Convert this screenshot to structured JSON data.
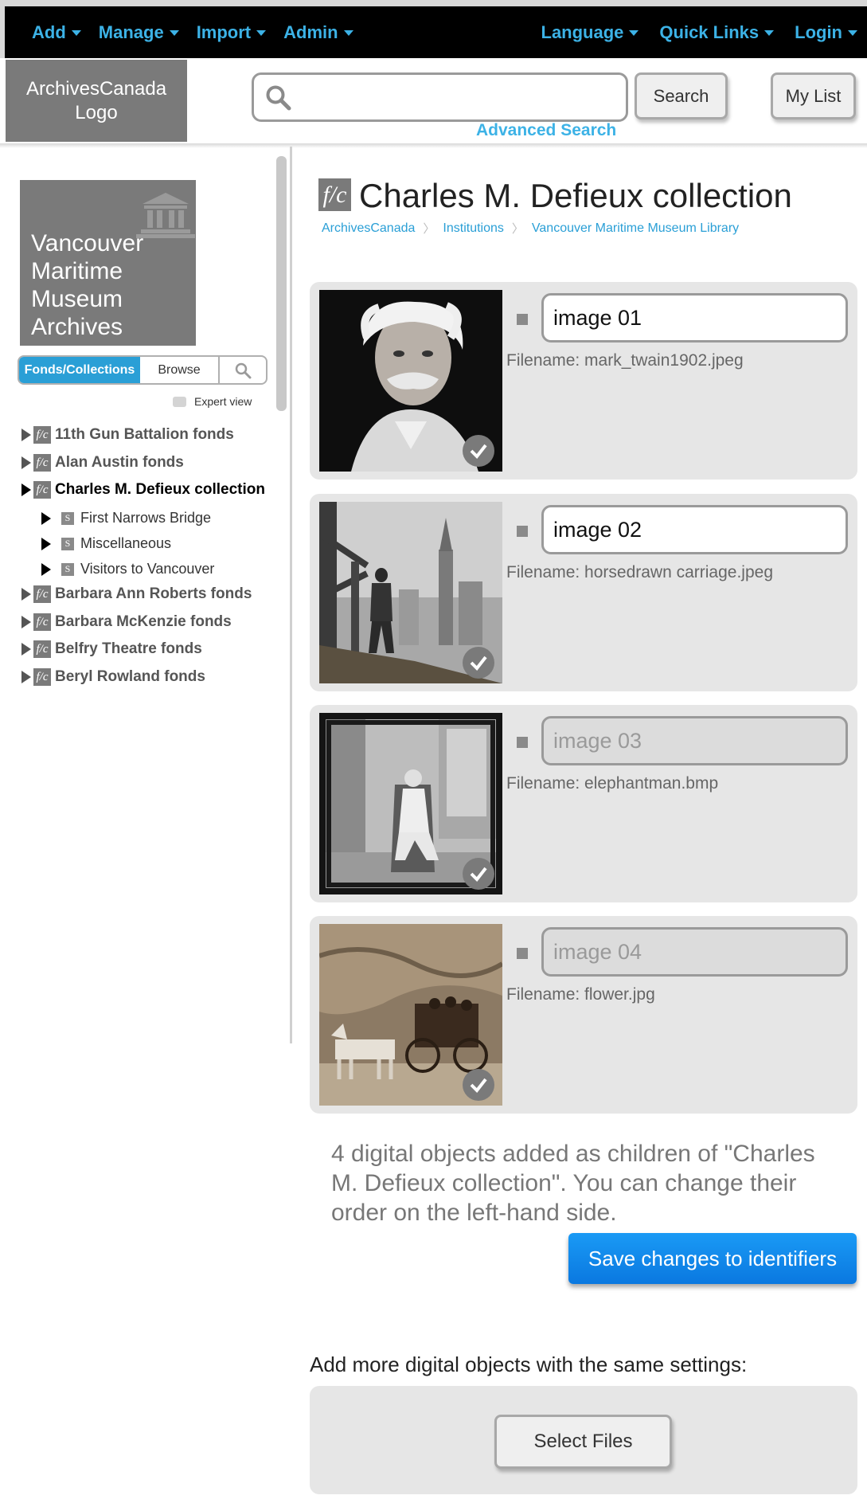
{
  "topnav": {
    "left": [
      {
        "label": "Add"
      },
      {
        "label": "Manage"
      },
      {
        "label": "Import"
      },
      {
        "label": "Admin"
      }
    ],
    "right": [
      {
        "label": "Language"
      },
      {
        "label": "Quick Links"
      },
      {
        "label": "Login"
      }
    ],
    "accent_color": "#3cb2e6"
  },
  "header": {
    "logo_text": "ArchivesCanada Logo",
    "search_value": "",
    "search_button": "Search",
    "my_list_button": "My List",
    "advanced_search": "Advanced Search"
  },
  "sidebar": {
    "institution_name": "Vancouver Maritime Museum Archives",
    "tabs": [
      {
        "label": "Fonds/Collections",
        "active": true
      },
      {
        "label": "Browse",
        "active": false
      }
    ],
    "expert_view_label": "Expert view",
    "tree": [
      {
        "label": "11th Gun Battalion fonds",
        "icon": "f/c"
      },
      {
        "label": "Alan Austin fonds",
        "icon": "f/c"
      },
      {
        "label": "Charles M. Defieux collection",
        "icon": "f/c",
        "active": true
      },
      {
        "label": "First Narrows Bridge",
        "icon": "S"
      },
      {
        "label": "Miscellaneous",
        "icon": "S"
      },
      {
        "label": "Visitors to Vancouver",
        "icon": "S"
      },
      {
        "label": "Barbara Ann Roberts fonds",
        "icon": "f/c"
      },
      {
        "label": "Barbara McKenzie fonds",
        "icon": "f/c"
      },
      {
        "label": "Belfry Theatre fonds",
        "icon": "f/c"
      },
      {
        "label": "Beryl Rowland fonds",
        "icon": "f/c"
      }
    ]
  },
  "main": {
    "title_icon": "f/c",
    "title": "Charles M. Defieux collection",
    "breadcrumb": [
      "ArchivesCanada",
      "Institutions",
      "Vancouver Maritime Museum Library"
    ],
    "objects": [
      {
        "identifier": "image 01",
        "filename": "Filename: mark_twain1902.jpeg"
      },
      {
        "identifier": "image 02",
        "filename": "Filename: horsedrawn carriage.jpeg"
      },
      {
        "identifier": "image 03",
        "filename": "Filename: elephantman.bmp"
      },
      {
        "identifier": "image 04",
        "filename": "Filename: flower.jpg"
      }
    ],
    "message": "4 digital objects added as children of \"Charles M. Defieux collection\". You can change their order on the left-hand side.",
    "save_button": "Save changes to identifiers",
    "add_more_label": "Add more digital objects with the same settings:",
    "select_files_button": "Select Files"
  }
}
